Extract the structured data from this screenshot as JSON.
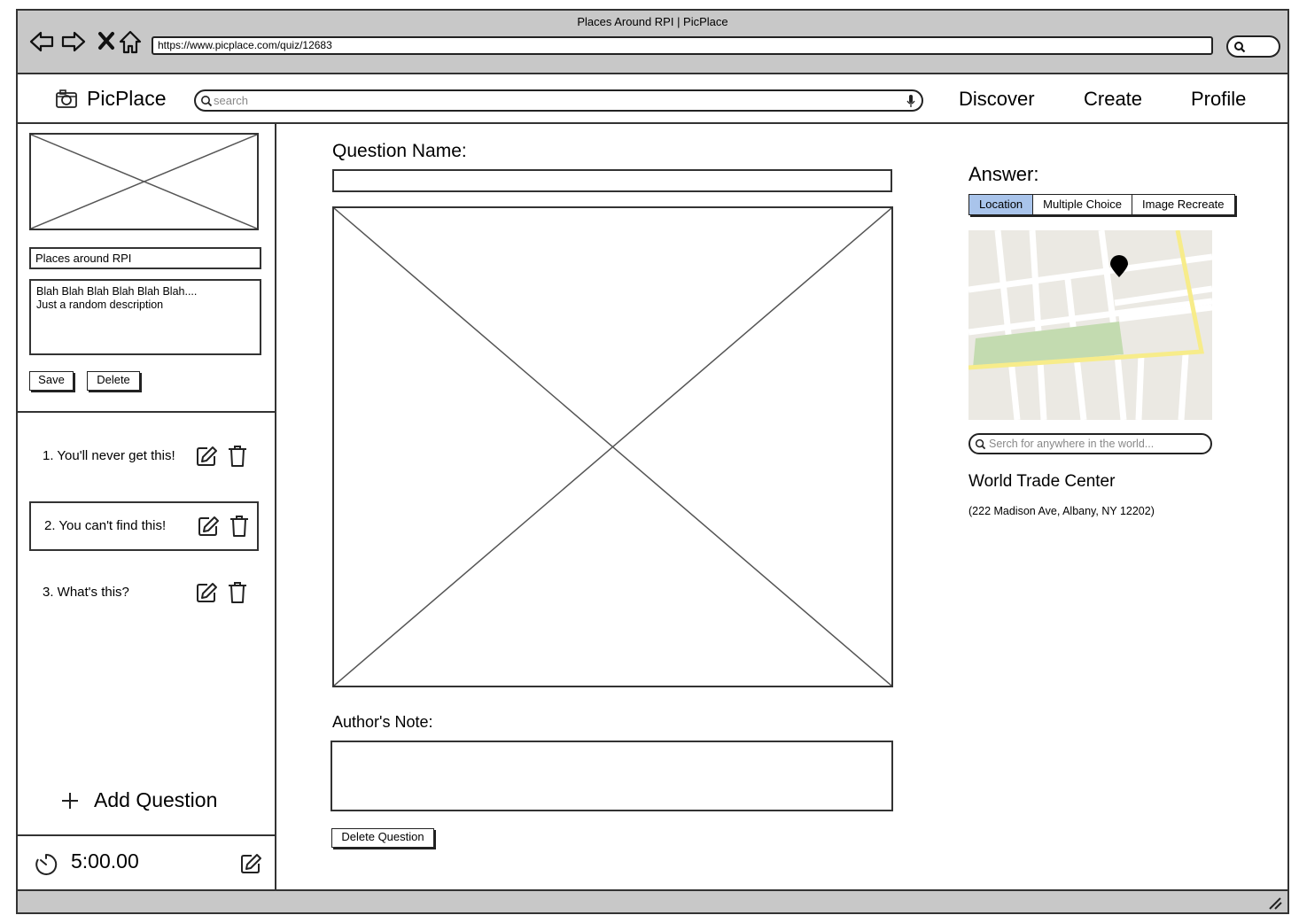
{
  "browser": {
    "title": "Places Around RPI | PicPlace",
    "url": "https://www.picplace.com/quiz/12683"
  },
  "app": {
    "name": "PicPlace",
    "search_placeholder": "search",
    "nav": {
      "discover": "Discover",
      "create": "Create",
      "profile": "Profile"
    }
  },
  "sidebar": {
    "quiz_title": "Places around RPI",
    "quiz_description": "Blah Blah Blah Blah Blah Blah....\nJust a random description",
    "save_label": "Save",
    "delete_label": "Delete",
    "questions": [
      {
        "label": "1. You'll never get this!"
      },
      {
        "label": "2. You can't find this!",
        "selected": true
      },
      {
        "label": "3. What's this?"
      }
    ],
    "add_question_label": "Add Question",
    "timer": "5:00.00"
  },
  "editor": {
    "question_name_label": "Question Name:",
    "authors_note_label": "Author's Note:",
    "delete_question_label": "Delete Question"
  },
  "answer": {
    "label": "Answer:",
    "tabs": [
      {
        "label": "Location",
        "active": true
      },
      {
        "label": "Multiple Choice"
      },
      {
        "label": "Image Recreate"
      }
    ],
    "map_search_placeholder": "Serch for anywhere in the world...",
    "place_name": "World Trade Center",
    "place_address": "(222 Madison Ave, Albany, NY 12202)"
  },
  "colors": {
    "chrome": "#c8c8c8",
    "active_tab": "#a9c4eb",
    "map_bg": "#ebe9e3",
    "map_park": "#c3dbb0",
    "map_highway": "#f7ec8a"
  }
}
